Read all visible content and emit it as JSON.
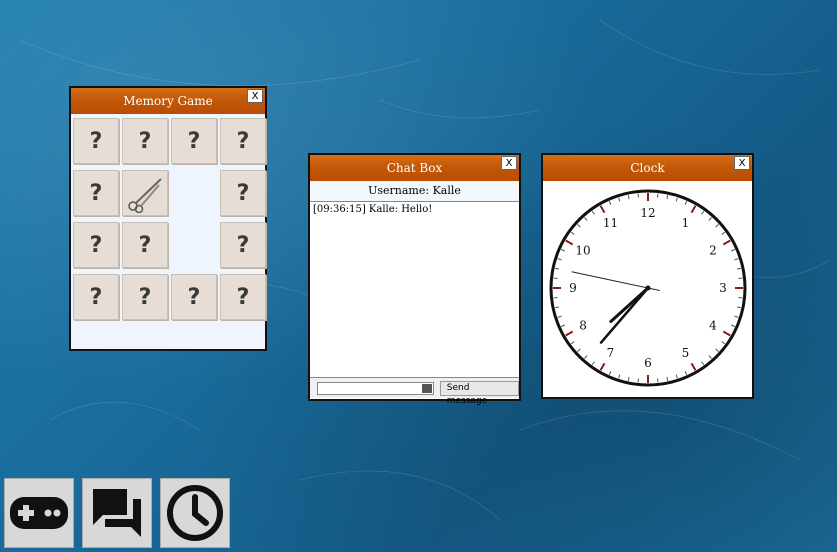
{
  "memory": {
    "title": "Memory Game",
    "close_label": "X",
    "cards": [
      {
        "row": 0,
        "col": 0,
        "state": "hidden",
        "label": "?"
      },
      {
        "row": 0,
        "col": 1,
        "state": "hidden",
        "label": "?"
      },
      {
        "row": 0,
        "col": 2,
        "state": "hidden",
        "label": "?"
      },
      {
        "row": 0,
        "col": 3,
        "state": "hidden",
        "label": "?"
      },
      {
        "row": 1,
        "col": 0,
        "state": "hidden",
        "label": "?"
      },
      {
        "row": 1,
        "col": 1,
        "state": "revealed",
        "icon": "scissors-icon"
      },
      {
        "row": 1,
        "col": 2,
        "state": "matched"
      },
      {
        "row": 1,
        "col": 3,
        "state": "hidden",
        "label": "?"
      },
      {
        "row": 2,
        "col": 0,
        "state": "hidden",
        "label": "?"
      },
      {
        "row": 2,
        "col": 1,
        "state": "hidden",
        "label": "?"
      },
      {
        "row": 2,
        "col": 2,
        "state": "matched"
      },
      {
        "row": 2,
        "col": 3,
        "state": "hidden",
        "label": "?"
      },
      {
        "row": 3,
        "col": 0,
        "state": "hidden",
        "label": "?"
      },
      {
        "row": 3,
        "col": 1,
        "state": "hidden",
        "label": "?"
      },
      {
        "row": 3,
        "col": 2,
        "state": "hidden",
        "label": "?"
      },
      {
        "row": 3,
        "col": 3,
        "state": "hidden",
        "label": "?"
      }
    ]
  },
  "chat": {
    "title": "Chat Box",
    "close_label": "X",
    "username_label": "Username: Kalle",
    "messages": [
      "[09:36:15] Kalle: Hello!"
    ],
    "input_value": "",
    "send_label": "Send message"
  },
  "clock": {
    "title": "Clock",
    "close_label": "X",
    "numbers": [
      "12",
      "1",
      "2",
      "3",
      "4",
      "5",
      "6",
      "7",
      "8",
      "9",
      "10",
      "11"
    ],
    "time": {
      "hour": 7,
      "minute": 36,
      "second": 47
    }
  },
  "taskbar": [
    {
      "name": "memory-game-launcher",
      "icon": "gamepad-icon"
    },
    {
      "name": "chat-launcher",
      "icon": "chat-bubbles-icon"
    },
    {
      "name": "clock-launcher",
      "icon": "clock-icon"
    }
  ],
  "colors": {
    "titlebar": "#c55a0a",
    "background": "#1a6e9e",
    "card": "#e6ded6"
  }
}
